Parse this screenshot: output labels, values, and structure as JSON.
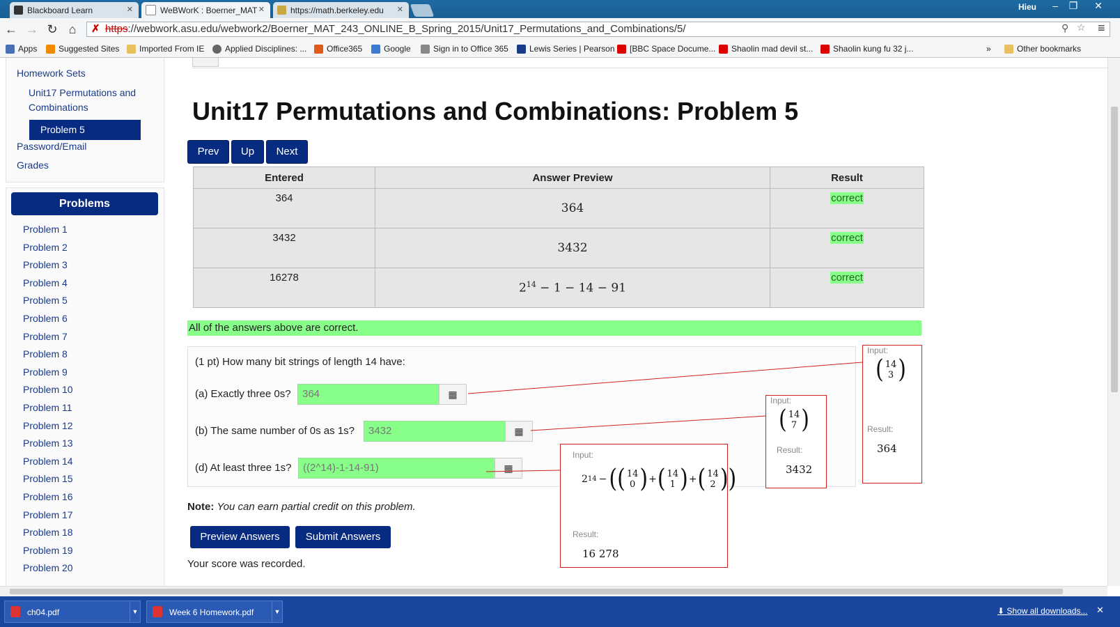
{
  "browser": {
    "tabs": [
      {
        "title": "Blackboard Learn",
        "favicon": "bb-icon"
      },
      {
        "title": "WeBWorK : Boerner_MAT",
        "favicon": "doc-icon"
      },
      {
        "title": "https://math.berkeley.edu",
        "favicon": "cal-icon"
      }
    ],
    "user": "Hieu",
    "url_scheme": "https",
    "url_rest": "://webwork.asu.edu/webwork2/Boerner_MAT_243_ONLINE_B_Spring_2015/Unit17_Permutations_and_Combinations/5/",
    "bookmarks": [
      "Apps",
      "Suggested Sites",
      "Imported From IE",
      "Applied Disciplines: ...",
      "Office365",
      "Google",
      "Sign in to Office 365",
      "Lewis Series | Pearson",
      "[BBC Space Docume...",
      "Shaolin mad devil st...",
      "Shaolin kung fu 32 j..."
    ],
    "bookmarks_overflow": "»",
    "other_bookmarks": "Other bookmarks"
  },
  "sidebar": {
    "homework_sets": "Homework Sets",
    "set_name": "Unit17 Permutations and Combinations",
    "current_problem": "Problem 5",
    "password_email": "Password/Email",
    "grades": "Grades",
    "problems_header": "Problems",
    "problems": [
      "Problem 1",
      "Problem 2",
      "Problem 3",
      "Problem 4",
      "Problem 5",
      "Problem 6",
      "Problem 7",
      "Problem 8",
      "Problem 9",
      "Problem 10",
      "Problem 11",
      "Problem 12",
      "Problem 13",
      "Problem 14",
      "Problem 15",
      "Problem 16",
      "Problem 17",
      "Problem 18",
      "Problem 19",
      "Problem 20"
    ]
  },
  "main": {
    "title": "Unit17 Permutations and Combinations: Problem 5",
    "nav": {
      "prev": "Prev",
      "up": "Up",
      "next": "Next"
    },
    "results_table": {
      "headers": [
        "Entered",
        "Answer Preview",
        "Result"
      ],
      "rows": [
        {
          "entered": "364",
          "preview": "364",
          "result": "correct"
        },
        {
          "entered": "3432",
          "preview": "3432",
          "result": "correct"
        },
        {
          "entered": "16278",
          "preview": "2^14 − 1 − 14 − 91",
          "result": "correct"
        }
      ]
    },
    "all_correct_msg": "All of the answers above are correct.",
    "question": "(1 pt) How many bit strings of length 14 have:",
    "parts": [
      {
        "label": "(a) Exactly three 0s?",
        "value": "364"
      },
      {
        "label": "(b) The same number of 0s as 1s?",
        "value": "3432"
      },
      {
        "label": "(d) At least three 1s?",
        "value": "((2^14)-1-14-91)"
      }
    ],
    "note_label": "Note:",
    "note_text": "You can earn partial credit on this problem.",
    "preview_btn": "Preview Answers",
    "submit_btn": "Submit Answers",
    "score_msg": "Your score was recorded."
  },
  "popups": {
    "input_label": "Input:",
    "result_label": "Result:",
    "a": {
      "binom_top": "14",
      "binom_bottom": "3",
      "result": "364"
    },
    "b": {
      "binom_top": "14",
      "binom_bottom": "7",
      "result": "3432"
    },
    "d": {
      "base": "2",
      "exp": "14",
      "result": "16 278",
      "terms": [
        {
          "top": "14",
          "bottom": "0"
        },
        {
          "top": "14",
          "bottom": "1"
        },
        {
          "top": "14",
          "bottom": "2"
        }
      ]
    }
  },
  "downloads": {
    "items": [
      "ch04.pdf",
      "Week 6 Homework.pdf"
    ],
    "show_all": "Show all downloads..."
  },
  "colors": {
    "nav_blue": "#082b82",
    "correct_green": "#88ff88",
    "popup_red": "#d02020"
  }
}
